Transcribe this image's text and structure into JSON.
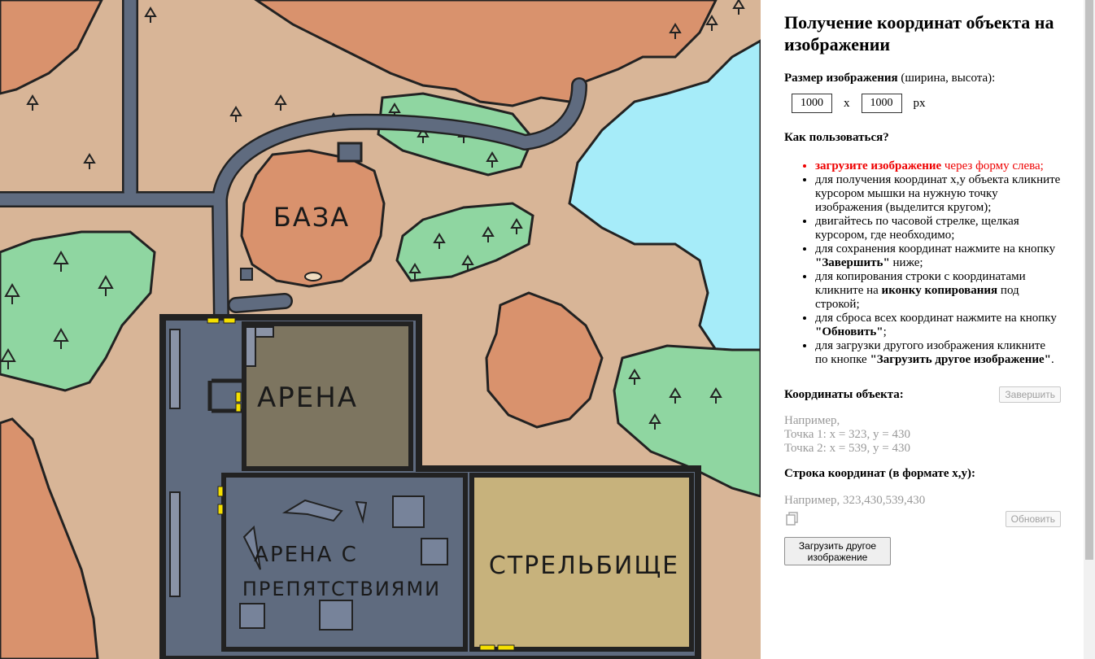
{
  "map": {
    "labels": {
      "base": "БАЗА",
      "arena": "АРЕНА",
      "arena_obstacles_1": "АРЕНА С",
      "arena_obstacles_2": "ПРЕПЯТСТВИЯМИ",
      "range": "СТРЕЛЬБИЩЕ"
    },
    "colors": {
      "ground": "#d8b597",
      "mountain": "#d9926d",
      "forest": "#8fd6a1",
      "water": "#a6ecf9",
      "road": "#5f6b7f",
      "wall": "#3a3a3a",
      "arena_floor": "#7d7560",
      "obstacle_floor": "#5f6b7f",
      "range_floor": "#c7b27c",
      "door": "#f5e000"
    }
  },
  "panel": {
    "title": "Получение координат объекта на изображении",
    "size_label_bold": "Размер изображения",
    "size_label_rest": " (ширина, высота):",
    "width_value": "1000",
    "height_value": "1000",
    "times": "x",
    "unit": "px",
    "howto_title": "Как пользоваться?",
    "steps": [
      {
        "bold": "загрузите изображение",
        "rest": " через форму слева;"
      },
      {
        "pre": "для получения координат x,y объекта кликните курсором мышки на нужную точку изображения (выделится кругом);"
      },
      {
        "pre": "двигайтесь по часовой стрелке, щелкая курсором, где необходимо;"
      },
      {
        "pre": "для сохранения координат нажмите на кнопку ",
        "bold": "\"Завершить\"",
        "post": " ниже;"
      },
      {
        "pre": "для копирования строки с координатами кликните на ",
        "bold": "иконку копирования",
        "post": " под строкой;"
      },
      {
        "pre": "для сброса всех координат нажмите на кнопку ",
        "bold": "\"Обновить\"",
        "post": ";"
      },
      {
        "pre": "для загрузки другого изображения кликните по кнопке ",
        "bold": "\"Загрузить другое изображение\"",
        "post": "."
      }
    ],
    "coords_title": "Координаты объекта:",
    "finish_button": "Завершить",
    "example_intro": "Например,",
    "example_point1": "Точка 1: x = 323, y = 430",
    "example_point2": "Точка 2: x = 539, y = 430",
    "string_title": "Строка координат (в формате x,y):",
    "string_example": "Например, 323,430,539,430",
    "copy_icon": "copy-icon",
    "refresh_button": "Обновить",
    "upload_button": "Загрузить другое изображение"
  }
}
